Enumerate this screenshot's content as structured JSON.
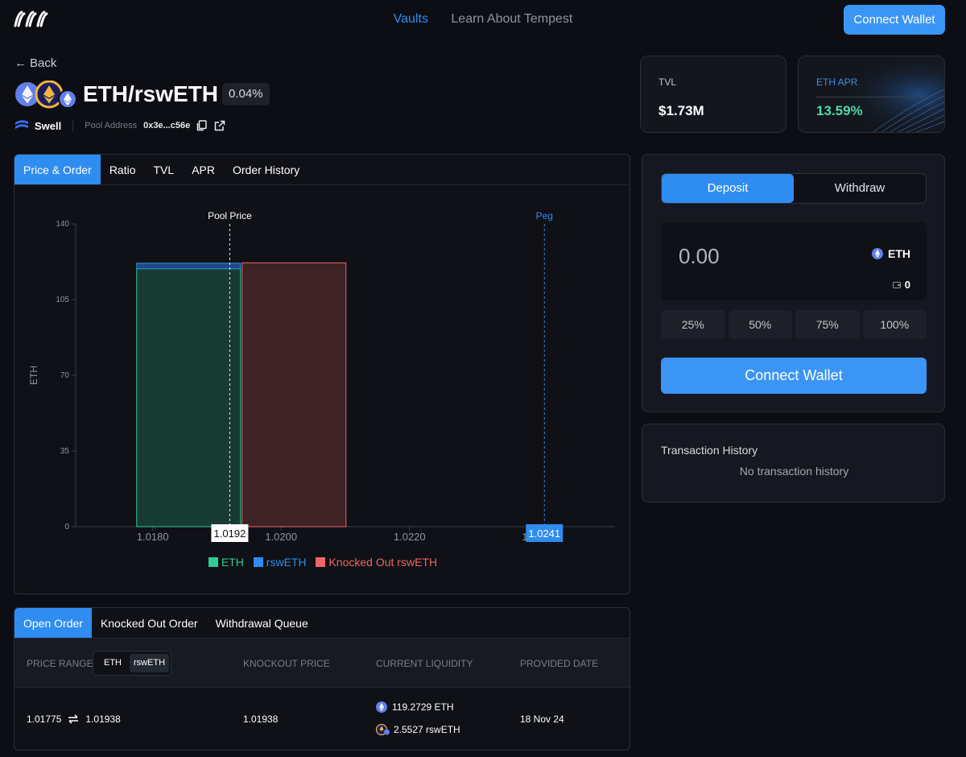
{
  "nav": {
    "items": [
      "Vaults",
      "Learn About Tempest"
    ],
    "connect_label": "Connect Wallet"
  },
  "header": {
    "back_label": "Back",
    "pair_title": "ETH/rswETH",
    "fee": "0.04%",
    "protocol": "Swell",
    "pool_address_label": "Pool Address",
    "pool_address": "0x3e...c56e"
  },
  "stats": {
    "tvl_label": "TVL",
    "tvl_value": "$1.73M",
    "apr_label": "ETH APR",
    "apr_value": "13.59%"
  },
  "chart_tabs": [
    "Price & Order",
    "Ratio",
    "TVL",
    "APR",
    "Order History"
  ],
  "chart_data": {
    "type": "bar",
    "ylabel": "ETH",
    "ylim": [
      0,
      140
    ],
    "yticks": [
      0,
      35,
      70,
      105,
      140
    ],
    "xlim": [
      1.0168,
      1.0252
    ],
    "xticks": [
      1.018,
      1.02,
      1.022,
      1.024
    ],
    "xtick_labels": [
      "1.0180",
      "1.0200",
      "1.0220",
      "1.0241"
    ],
    "series": [
      {
        "name": "ETH",
        "color": "#2ecc93",
        "bars": [
          {
            "x0": 1.01775,
            "x1": 1.01938,
            "value": 119.27
          }
        ]
      },
      {
        "name": "rswETH",
        "color": "#2f8cf0",
        "bars": [
          {
            "x0": 1.01775,
            "x1": 1.01938,
            "value": 2.55
          }
        ]
      },
      {
        "name": "Knocked Out rswETH",
        "color": "#f06565",
        "bars": [
          {
            "x0": 1.01938,
            "x1": 1.02101,
            "value": 122
          }
        ]
      }
    ],
    "markers": [
      {
        "label": "Pool Price",
        "x": 1.0192,
        "value_label": "1.0192"
      },
      {
        "label": "Peg",
        "x": 1.0241,
        "value_label": "1.0241"
      }
    ]
  },
  "deposit": {
    "tabs": [
      "Deposit",
      "Withdraw"
    ],
    "amount": "0.00",
    "token": "ETH",
    "balance": "0",
    "percents": [
      "25%",
      "50%",
      "75%",
      "100%"
    ],
    "connect_label": "Connect Wallet"
  },
  "tx_history": {
    "title": "Transaction History",
    "empty": "No transaction history"
  },
  "orders": {
    "tabs": [
      "Open Order",
      "Knocked Out Order",
      "Withdrawal Queue"
    ],
    "headers": [
      "PRICE RANGE",
      "KNOCKOUT PRICE",
      "CURRENT LIQUIDITY",
      "PROVIDED DATE"
    ],
    "toggle": [
      "ETH",
      "rswETH"
    ],
    "rows": [
      {
        "range_low": "1.01775",
        "range_high": "1.01938",
        "knockout": "1.01938",
        "liquidity_eth": "119.2729 ETH",
        "liquidity_rsweth": "2.5527 rswETH",
        "date": "18 Nov 24"
      }
    ]
  }
}
